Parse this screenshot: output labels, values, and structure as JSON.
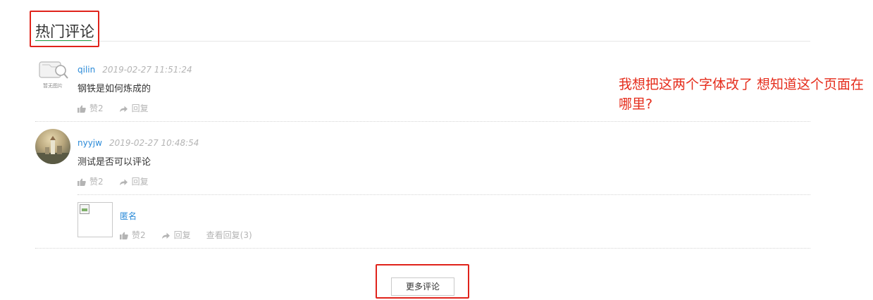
{
  "section": {
    "title": "热门评论"
  },
  "comments": [
    {
      "avatar_label": "暂无图片",
      "username": "qilin",
      "time": "2019-02-27 11:51:24",
      "text": "钢铁是如何炼成的",
      "like_label": "赞2",
      "reply_label": "回复"
    },
    {
      "username": "nyyjw",
      "time": "2019-02-27 10:48:54",
      "text": "测试是否可以评论",
      "like_label": "赞2",
      "reply_label": "回复",
      "replies": [
        {
          "username": "匿名",
          "like_label": "赞2",
          "reply_label": "回复",
          "view_replies_label": "查看回复(3)"
        }
      ]
    }
  ],
  "more_button": {
    "label": "更多评论"
  },
  "annotation": {
    "text": "我想把这两个字体改了 想知道这个页面在哪里?"
  },
  "colors": {
    "highlight": "#e0231b",
    "link": "#2a8ad8",
    "muted": "#b4b4b4",
    "accent_underline": "#2ba34a",
    "annotation": "#e52d1c"
  }
}
